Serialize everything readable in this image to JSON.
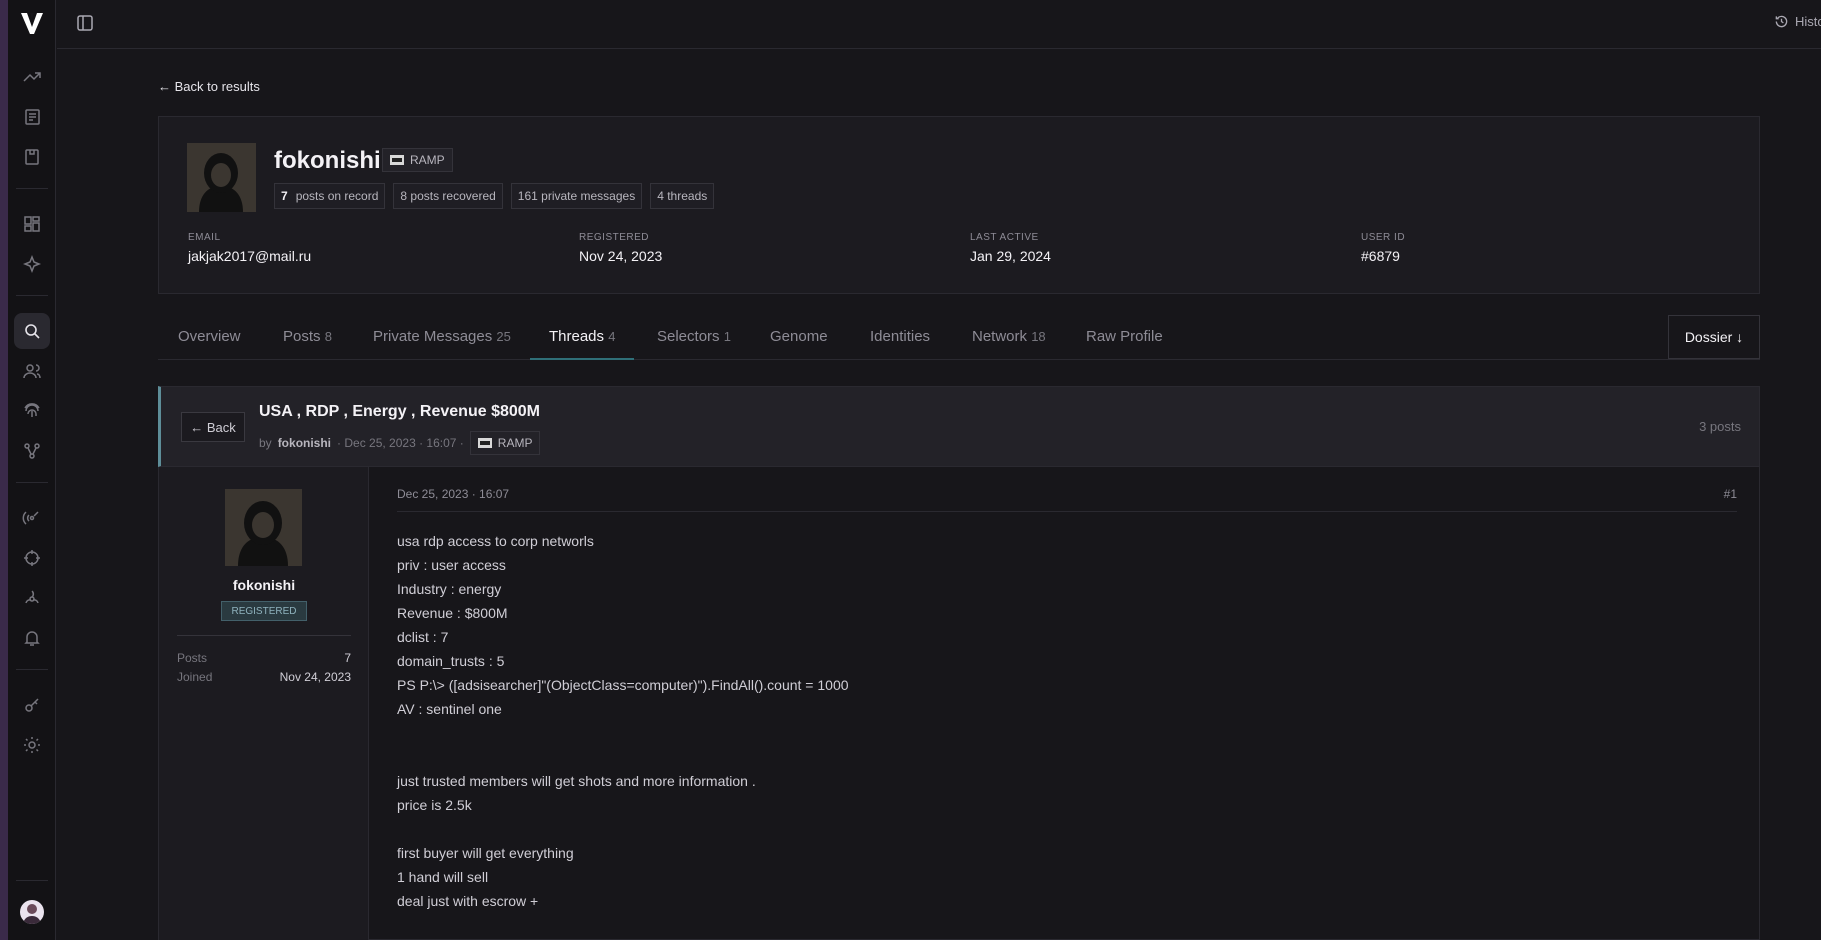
{
  "header": {
    "history_label": "Histo"
  },
  "back_to_results": "← Back to results",
  "profile": {
    "username": "fokonishi",
    "forum": "RAMP",
    "stats": {
      "posts_count": "7",
      "posts_label": "posts on record",
      "recovered": "8 posts recovered",
      "pms": "161 private messages",
      "threads": "4 threads"
    },
    "fields": [
      {
        "label": "EMAIL",
        "value": "jakjak2017@mail.ru"
      },
      {
        "label": "REGISTERED",
        "value": "Nov 24, 2023"
      },
      {
        "label": "LAST ACTIVE",
        "value": "Jan 29, 2024"
      },
      {
        "label": "USER ID",
        "value": "#6879"
      }
    ]
  },
  "tabs": [
    {
      "label": "Overview",
      "count": ""
    },
    {
      "label": "Posts",
      "count": "8"
    },
    {
      "label": "Private Messages",
      "count": "25"
    },
    {
      "label": "Threads",
      "count": "4"
    },
    {
      "label": "Selectors",
      "count": "1"
    },
    {
      "label": "Genome",
      "count": ""
    },
    {
      "label": "Identities",
      "count": ""
    },
    {
      "label": "Network",
      "count": "18"
    },
    {
      "label": "Raw Profile",
      "count": ""
    }
  ],
  "dossier_label": "Dossier ↓",
  "thread": {
    "back_label": "← Back",
    "title": "USA , RDP , Energy , Revenue $800M",
    "by": "by",
    "author": "fokonishi",
    "date": "· Dec 25, 2023 · 16:07 ·",
    "forum": "RAMP",
    "post_count": "3 posts"
  },
  "post": {
    "author": "fokonishi",
    "badge": "REGISTERED",
    "posts_label": "Posts",
    "posts_value": "7",
    "joined_label": "Joined",
    "joined_value": "Nov 24, 2023",
    "date": "Dec 25, 2023 · 16:07",
    "number": "#1",
    "lines": [
      "usa rdp access to corp networls",
      "priv : user access",
      "Industry : energy",
      "Revenue : $800M",
      "dclist : 7",
      "domain_trusts : 5",
      "PS P:\\> ([adsisearcher]\"(ObjectClass=computer)\").FindAll().count = 1000",
      "AV : sentinel one",
      "",
      "",
      "just trusted members will get shots and more information .",
      "price is 2.5k",
      "",
      "first buyer will get everything",
      "1 hand will sell",
      "deal just with escrow +"
    ]
  }
}
